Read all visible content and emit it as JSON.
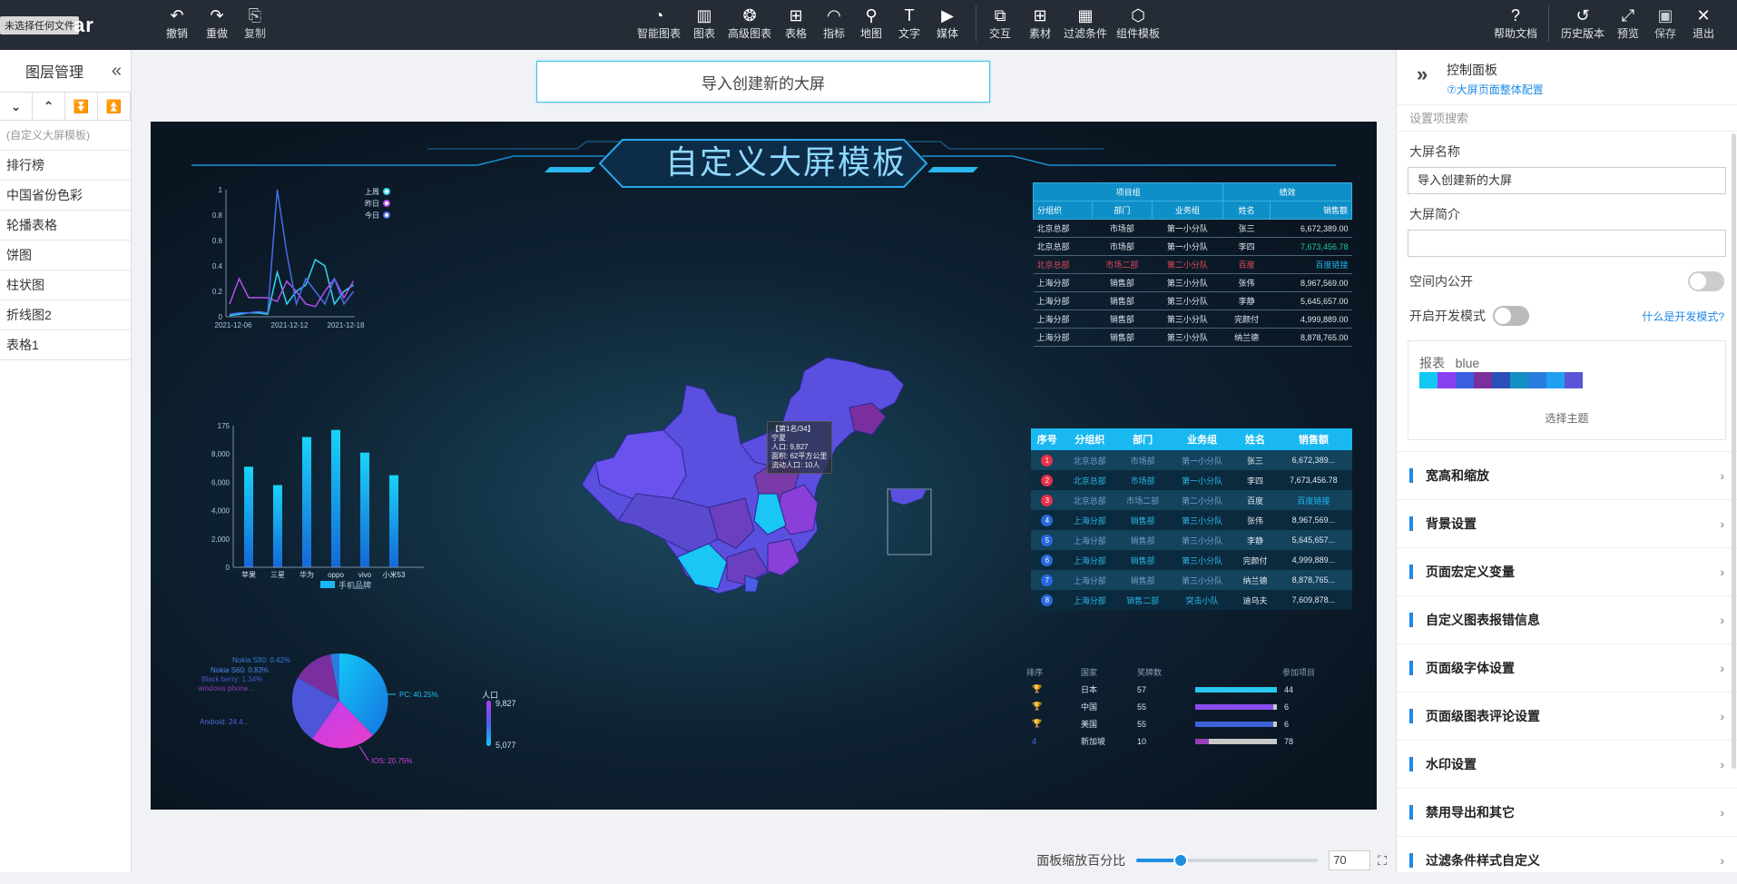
{
  "app": {
    "tooltip": "未选择任何文件",
    "brand": "ar"
  },
  "toolbar": {
    "undo": "撤销",
    "redo": "重做",
    "copy": "复制",
    "smart_chart": "智能图表",
    "chart": "图表",
    "adv_chart": "高级图表",
    "table": "表格",
    "indicator": "指标",
    "map": "地图",
    "text": "文字",
    "media": "媒体",
    "interact": "交互",
    "material": "素材",
    "filter": "过滤条件",
    "component_tpl": "组件模板",
    "help": "帮助文档",
    "history": "历史版本",
    "preview": "预览",
    "save": "保存",
    "exit": "退出"
  },
  "layers": {
    "title": "图层管理",
    "items": [
      "(自定义大屏模板)",
      "排行榜",
      "中国省份色彩",
      "轮播表格",
      "饼图",
      "柱状图",
      "折线图2",
      "表格1"
    ]
  },
  "screen": {
    "name_box": "导入创建新的大屏",
    "title": "自定义大屏模板"
  },
  "line_chart": {
    "y_ticks": [
      "1",
      "0.8",
      "0.6",
      "0.4",
      "0.2",
      "0"
    ],
    "x_ticks": [
      "2021-12-06",
      "2021-12-12",
      "2021-12-18"
    ],
    "legend": [
      "上周",
      "昨日",
      "今日"
    ]
  },
  "bar_chart": {
    "y_ticks": [
      "175",
      "8,000",
      "6,000",
      "4,000",
      "2,000",
      "0"
    ],
    "categories": [
      "苹果",
      "三星",
      "华为",
      "oppo",
      "vivo",
      "小米53"
    ],
    "legend": "手机品牌"
  },
  "pie_chart": {
    "labels": [
      "Nokia S80: 0.42%",
      "Nokia S60: 0.83%",
      "Black berry: 1.34%",
      "windows phone...",
      "Android: 24.4...",
      "PC: 40.25%",
      "IOS: 20.75%"
    ]
  },
  "visual_map": {
    "label": "人口",
    "max": "9,827",
    "min": "5,077"
  },
  "map_tooltip": {
    "lines": [
      "【第1名/34】",
      "宁夏",
      "人口: 9,827",
      "面积: 62平方公里",
      "流动人口: 10人"
    ]
  },
  "top_table": {
    "groups": [
      "项目组",
      "绩效"
    ],
    "headers": [
      "分组织",
      "部门",
      "业务组",
      "姓名",
      "销售额"
    ],
    "rows": [
      [
        "北京总部",
        "市场部",
        "第一小分队",
        "张三",
        "6,672,389.00"
      ],
      [
        "北京总部",
        "市场部",
        "第一小分队",
        "李四",
        "7,673,456.78"
      ],
      [
        "北京总部",
        "市场二部",
        "第二小分队",
        "百度",
        "百度链接"
      ],
      [
        "上海分部",
        "销售部",
        "第三小分队",
        "张伟",
        "8,967,569.00"
      ],
      [
        "上海分部",
        "销售部",
        "第三小分队",
        "李静",
        "5,645,657.00"
      ],
      [
        "上海分部",
        "销售部",
        "第三小分队",
        "完颜付",
        "4,999,889.00"
      ],
      [
        "上海分部",
        "销售部",
        "第三小分队",
        "纳兰德",
        "8,878,765.00"
      ]
    ]
  },
  "carousel_table": {
    "headers": [
      "序号",
      "分组织",
      "部门",
      "业务组",
      "姓名",
      "销售额"
    ],
    "rows": [
      [
        "1",
        "北京总部",
        "市场部",
        "第一小分队",
        "张三",
        "6,672,389..."
      ],
      [
        "2",
        "北京总部",
        "市场部",
        "第一小分队",
        "李四",
        "7,673,456.78"
      ],
      [
        "3",
        "北京总部",
        "市场二部",
        "第二小分队",
        "百度",
        "百度链接"
      ],
      [
        "4",
        "上海分部",
        "销售部",
        "第三小分队",
        "张伟",
        "8,967,569..."
      ],
      [
        "5",
        "上海分部",
        "销售部",
        "第三小分队",
        "李静",
        "5,645,657..."
      ],
      [
        "6",
        "上海分部",
        "销售部",
        "第三小分队",
        "完颜付",
        "4,999,889..."
      ],
      [
        "7",
        "上海分部",
        "销售部",
        "第三小分队",
        "纳兰德",
        "8,878,765..."
      ],
      [
        "8",
        "上海分部",
        "销售二部",
        "突击小队",
        "迪乌夫",
        "7,609,878..."
      ]
    ]
  },
  "ranking": {
    "headers": [
      "排序",
      "国家",
      "奖牌数",
      "参加项目"
    ],
    "rows": [
      {
        "rank": "",
        "country": "日本",
        "medals": "57",
        "projects": "44",
        "pct": 1.0,
        "color": "#28c8f0"
      },
      {
        "rank": "",
        "country": "中国",
        "medals": "55",
        "projects": "6",
        "pct": 0.96,
        "color": "#8a4cf0"
      },
      {
        "rank": "",
        "country": "美国",
        "medals": "55",
        "projects": "6",
        "pct": 0.96,
        "color": "#3d62d8"
      },
      {
        "rank": "4",
        "country": "新加坡",
        "medals": "10",
        "projects": "78",
        "pct": 0.17,
        "color": "#9b3fb8"
      }
    ]
  },
  "zoom": {
    "label": "面板缩放百分比",
    "value": "70",
    "percent": 70
  },
  "panel": {
    "title": "控制面板",
    "link": "⑦大屏页面整体配置",
    "search_placeholder": "设置项搜索",
    "name_label": "大屏名称",
    "name_value": "导入创建新的大屏",
    "intro_label": "大屏简介",
    "intro_value": "",
    "space_public": "空间内公开",
    "dev_mode": "开启开发模式",
    "dev_link": "什么是开发模式?",
    "theme_label": "报表",
    "theme_name": "blue",
    "theme_swatches": [
      "#12c7f2",
      "#8a3ff0",
      "#3b5fe0",
      "#7b2f9e",
      "#2a4fb8",
      "#148fc4",
      "#2a7de0",
      "#1fa0f0",
      "#5a55d8"
    ],
    "choose_theme": "选择主题",
    "sections": [
      "宽高和缩放",
      "背景设置",
      "页面宏定义变量",
      "自定义图表报错信息",
      "页面级字体设置",
      "页面级图表评论设置",
      "水印设置",
      "禁用导出和其它",
      "过滤条件样式自定义"
    ]
  }
}
